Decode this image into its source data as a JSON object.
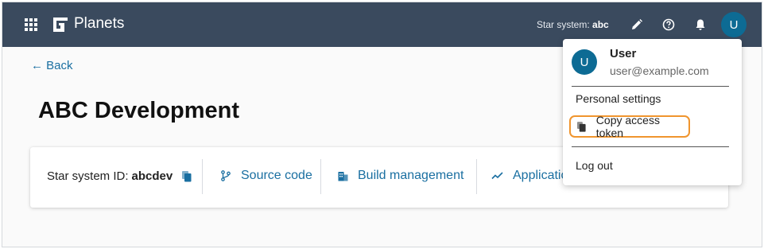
{
  "header": {
    "app_title": "Planets",
    "star_system_label": "Star system:",
    "star_system_value": "abc",
    "avatar_initial": "U"
  },
  "page": {
    "back_label": "← Back",
    "title": "ABC Development"
  },
  "card": {
    "system_id_label": "Star system ID:",
    "system_id_value": "abcdev",
    "links": {
      "source_code": "Source code",
      "build_management": "Build management",
      "applications": "Applications"
    }
  },
  "user_menu": {
    "avatar_initial": "U",
    "username": "User",
    "email": "user@example.com",
    "personal_settings": "Personal settings",
    "copy_access_token": "Copy access token",
    "log_out": "Log out"
  },
  "colors": {
    "header_bg": "#3a4a5e",
    "link": "#1a6fa1",
    "avatar_bg": "#0d6b94",
    "focus_ring": "#f0952e"
  },
  "icons": [
    "apps-grid-icon",
    "planets-logo-icon",
    "edit-pencil-icon",
    "help-icon",
    "bell-icon",
    "copy-icon",
    "source-branch-icon",
    "building-icon",
    "trend-chart-icon"
  ]
}
